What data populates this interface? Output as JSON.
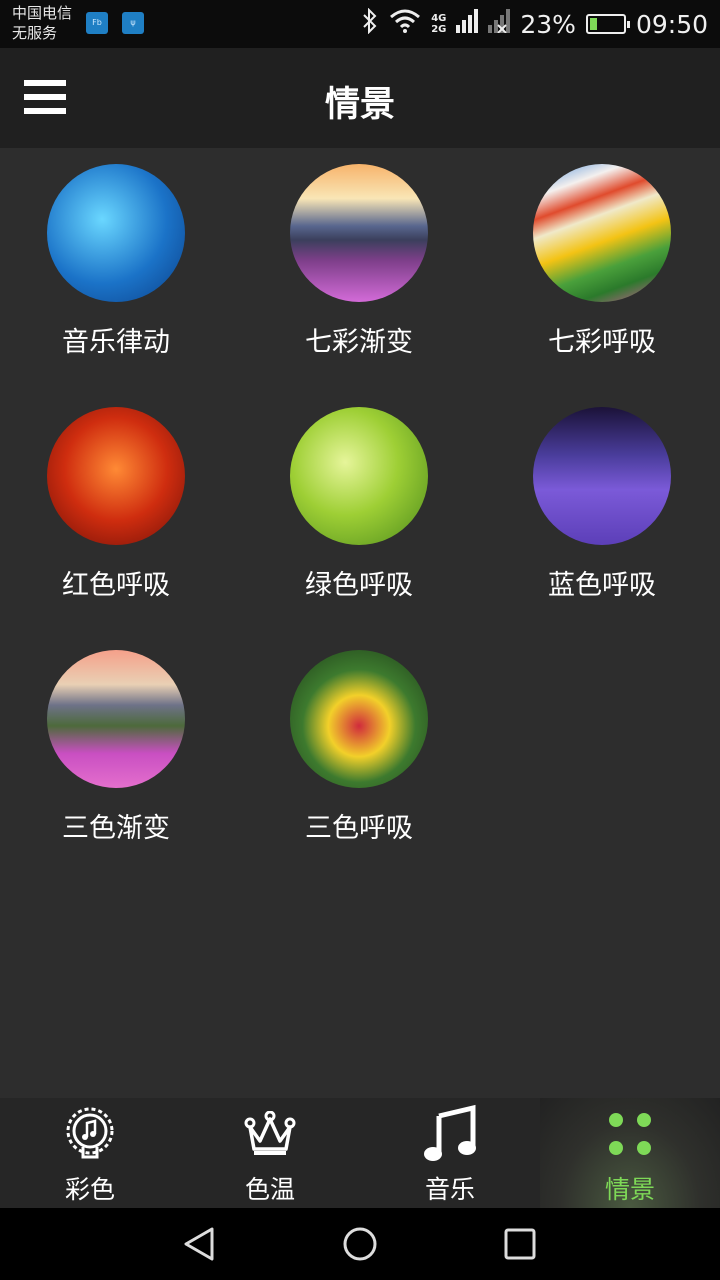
{
  "status_bar": {
    "carrier_line1": "中国电信",
    "carrier_line2": "无服务",
    "network_top": "4G",
    "network_bottom": "2G",
    "battery_percent": "23%",
    "battery_level": 0.23,
    "time": "09:50"
  },
  "header": {
    "title": "情景",
    "menu_icon": "hamburger-menu-icon"
  },
  "scenes": [
    {
      "label": "音乐律动"
    },
    {
      "label": "七彩渐变"
    },
    {
      "label": "七彩呼吸"
    },
    {
      "label": "红色呼吸"
    },
    {
      "label": "绿色呼吸"
    },
    {
      "label": "蓝色呼吸"
    },
    {
      "label": "三色渐变"
    },
    {
      "label": "三色呼吸"
    }
  ],
  "bottom_nav": {
    "active_index": 3,
    "active_color": "#7ed957",
    "tabs": [
      {
        "label": "彩色",
        "icon": "music-bulb-icon"
      },
      {
        "label": "色温",
        "icon": "crown-icon"
      },
      {
        "label": "音乐",
        "icon": "music-note-icon"
      },
      {
        "label": "情景",
        "icon": "four-dots-icon"
      }
    ]
  },
  "system_nav": {
    "buttons": [
      "back-icon",
      "home-icon",
      "recents-icon"
    ]
  }
}
